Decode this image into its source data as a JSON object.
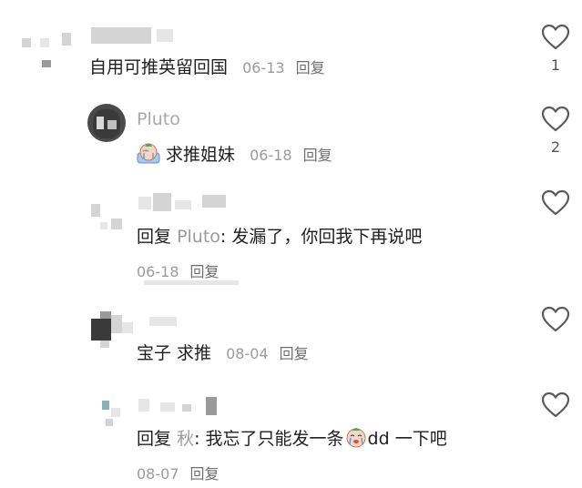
{
  "comments": [
    {
      "text": "自用可推英留回国",
      "date": "06-13",
      "reply_label": "回复",
      "likes": "1"
    },
    {
      "user": "Pluto",
      "text": "求推姐妹",
      "emoji": "crying-sticker-icon",
      "date": "06-18",
      "reply_label": "回复",
      "likes": "2"
    },
    {
      "prefix": "回复",
      "mention": "Pluto",
      "text": ": 发漏了，你回我下再说吧",
      "date": "06-18",
      "reply_label": "回复"
    },
    {
      "text": "宝子 求推",
      "date": "08-04",
      "reply_label": "回复"
    },
    {
      "prefix": "回复",
      "mention": "秋",
      "text": ": 我忘了只能发一条",
      "emoji": "crying-sticker-icon",
      "text_after": "dd 一下吧",
      "date": "08-07",
      "reply_label": "回复"
    }
  ],
  "colors": {
    "heart_stroke": "#5a5a5a",
    "secondary_text": "#9b9b9b",
    "primary_text": "#1f1f1f"
  }
}
